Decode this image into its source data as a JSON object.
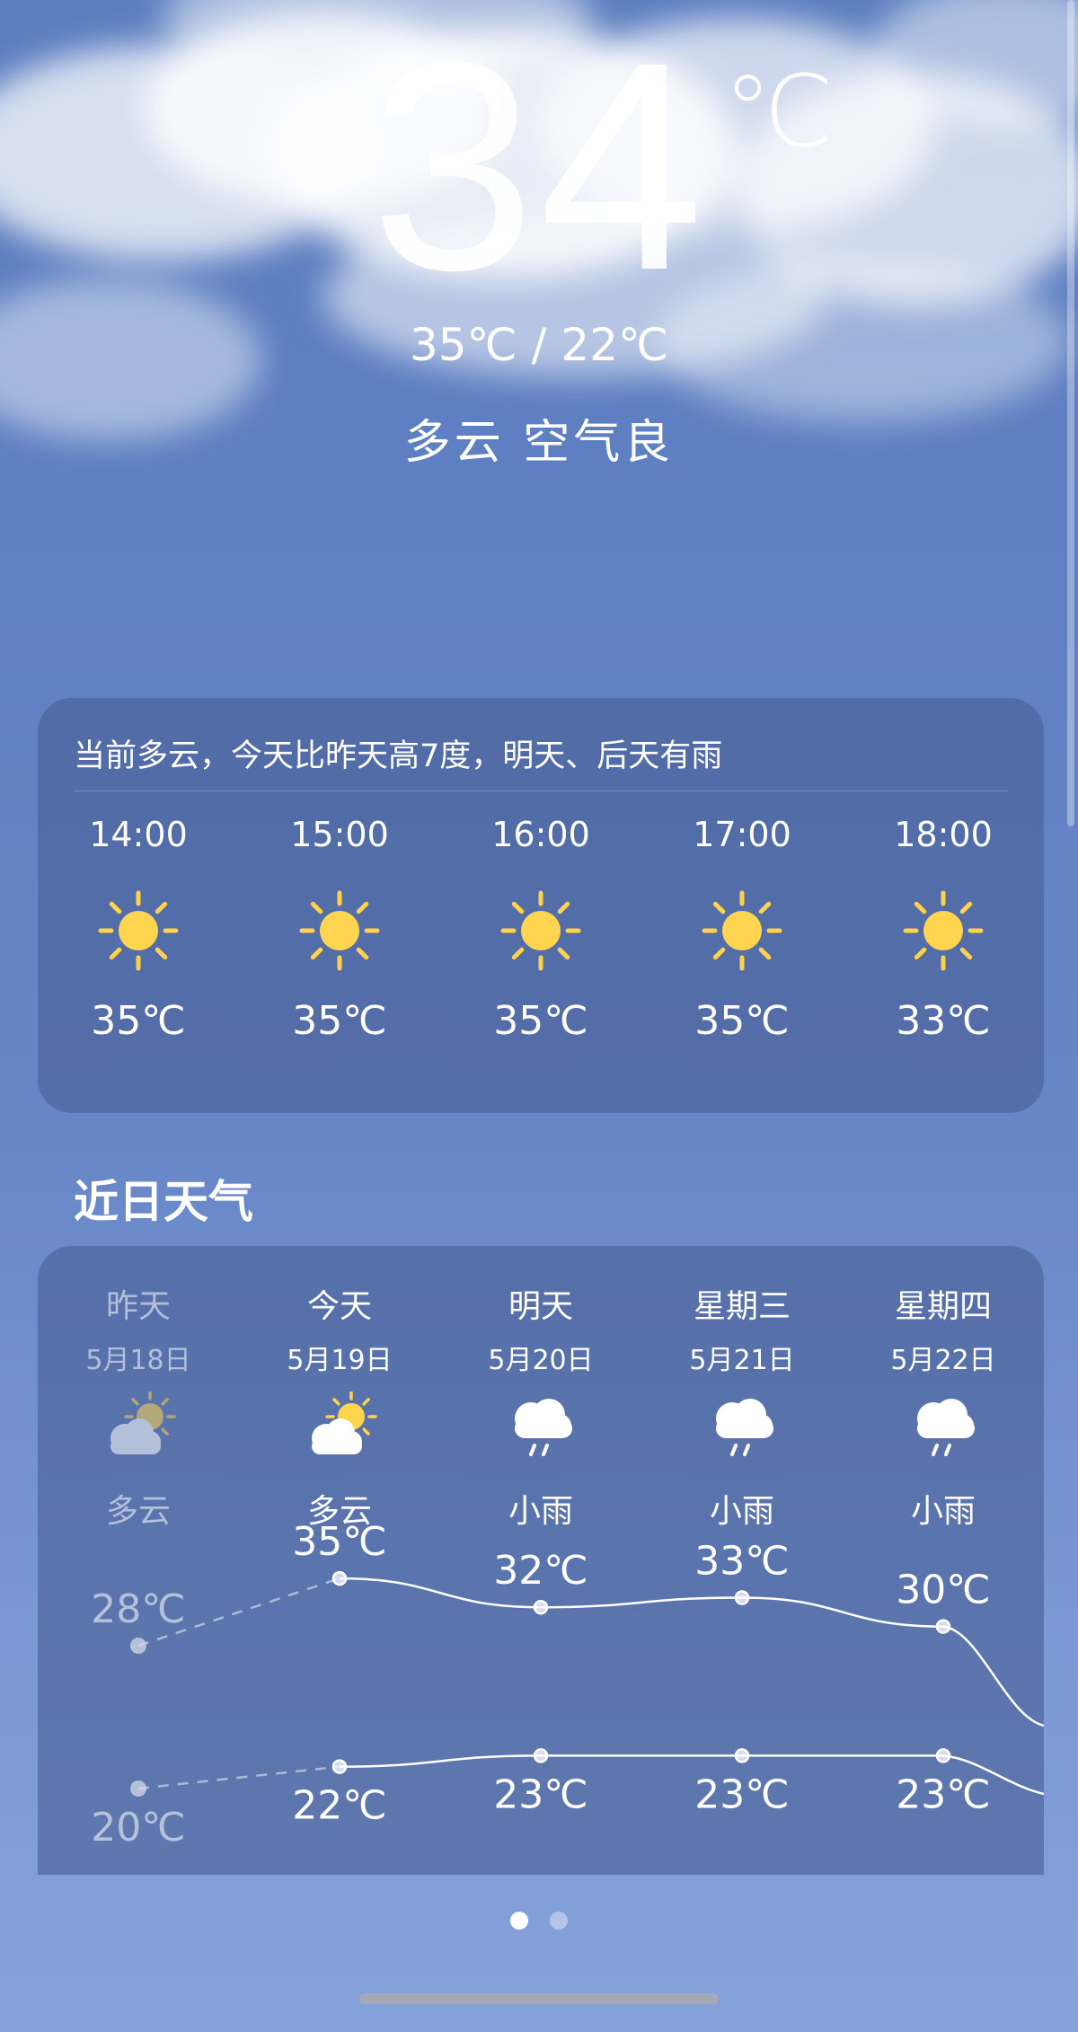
{
  "current": {
    "temp": "34",
    "unit": "℃",
    "range": "35℃ / 22℃",
    "condition": "多云  空气良"
  },
  "summary": "当前多云，今天比昨天高7度，明天、后天有雨",
  "hourly": [
    {
      "time": "14:00",
      "icon": "sun-icon",
      "temp": "35℃"
    },
    {
      "time": "15:00",
      "icon": "sun-icon",
      "temp": "35℃"
    },
    {
      "time": "16:00",
      "icon": "sun-icon",
      "temp": "35℃"
    },
    {
      "time": "17:00",
      "icon": "sun-icon",
      "temp": "35℃"
    },
    {
      "time": "18:00",
      "icon": "sun-icon",
      "temp": "33℃"
    }
  ],
  "section_title": "近日天气",
  "daily": [
    {
      "name": "昨天",
      "date": "5月18日",
      "icon": "partly-cloudy-icon",
      "condition": "多云",
      "high": "28℃",
      "low": "20℃",
      "high_val": 28,
      "low_val": 20,
      "past": true
    },
    {
      "name": "今天",
      "date": "5月19日",
      "icon": "partly-cloudy-icon",
      "condition": "多云",
      "high": "35℃",
      "low": "22℃",
      "high_val": 35,
      "low_val": 22,
      "past": false
    },
    {
      "name": "明天",
      "date": "5月20日",
      "icon": "light-rain-icon",
      "condition": "小雨",
      "high": "32℃",
      "low": "23℃",
      "high_val": 32,
      "low_val": 23,
      "past": false
    },
    {
      "name": "星期三",
      "date": "5月21日",
      "icon": "light-rain-icon",
      "condition": "小雨",
      "high": "33℃",
      "low": "23℃",
      "high_val": 33,
      "low_val": 23,
      "past": false
    },
    {
      "name": "星期四",
      "date": "5月22日",
      "icon": "light-rain-icon",
      "condition": "小雨",
      "high": "30℃",
      "low": "23℃",
      "high_val": 30,
      "low_val": 23,
      "past": false
    }
  ],
  "pagination": {
    "total": 2,
    "active": 1
  }
}
